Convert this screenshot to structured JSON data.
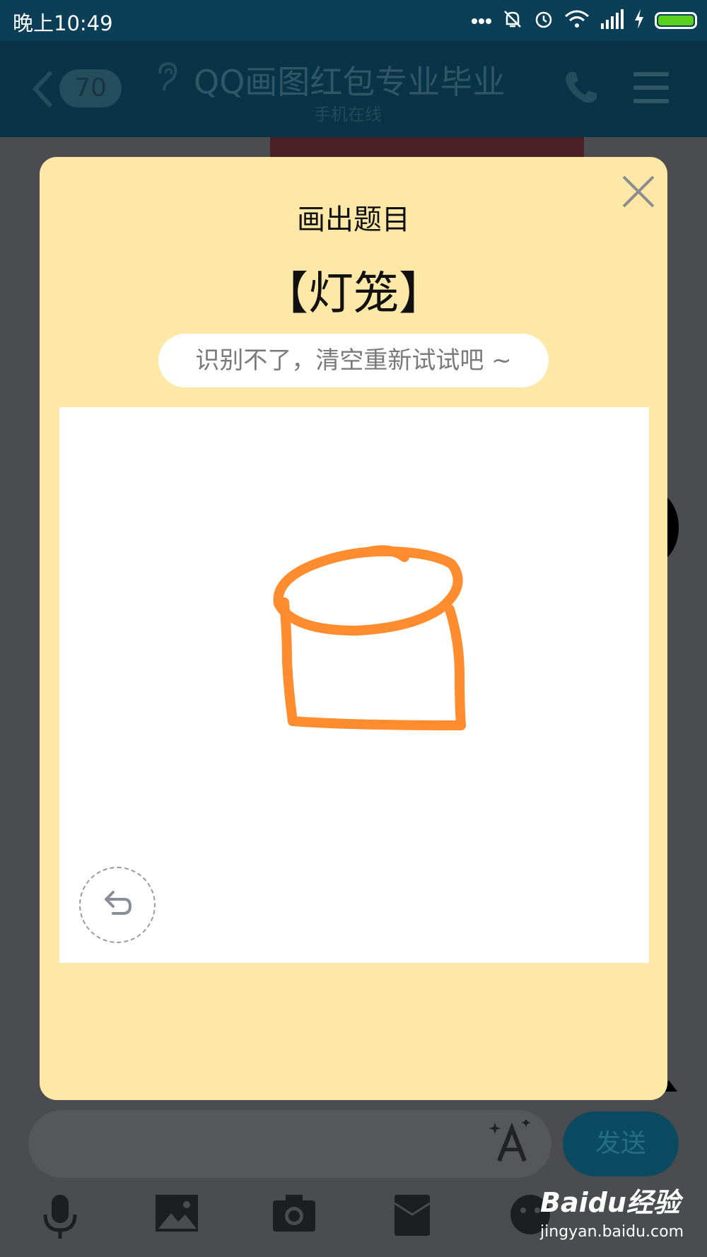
{
  "status_bar": {
    "time": "晚上10:49",
    "icons": [
      "more-dots-icon",
      "mute-icon",
      "alarm-icon",
      "wifi-icon",
      "signal-icon",
      "charging-icon",
      "battery-icon"
    ]
  },
  "title_bar": {
    "back_icon": "chevron-left-icon",
    "unread_count": "70",
    "title": "QQ画图红包专业毕业",
    "subtitle": "手机在线",
    "ear_icon": "ear-icon",
    "phone_icon": "phone-icon",
    "menu_icon": "menu-icon"
  },
  "modal": {
    "title": "画出题目",
    "prompt_word": "【灯笼】",
    "hint": "识别不了，清空重新试试吧 ~",
    "close_icon": "close-icon",
    "undo_icon": "undo-icon",
    "stroke_color": "#ff8c2e"
  },
  "input_bar": {
    "send_label": "发送",
    "font_icon": "font-style-icon"
  },
  "toolbar": {
    "icons": [
      "microphone-icon",
      "image-icon",
      "camera-icon",
      "red-packet-icon",
      "emoji-icon"
    ]
  },
  "watermark": {
    "brand": "Baidu经验",
    "domain": "jingyan.baidu.com"
  },
  "colors": {
    "status_bar_bg": "#0b3f57",
    "modal_bg": "#fde8a8",
    "overlay": "#4a4c50",
    "send_button": "#0b4a60"
  }
}
